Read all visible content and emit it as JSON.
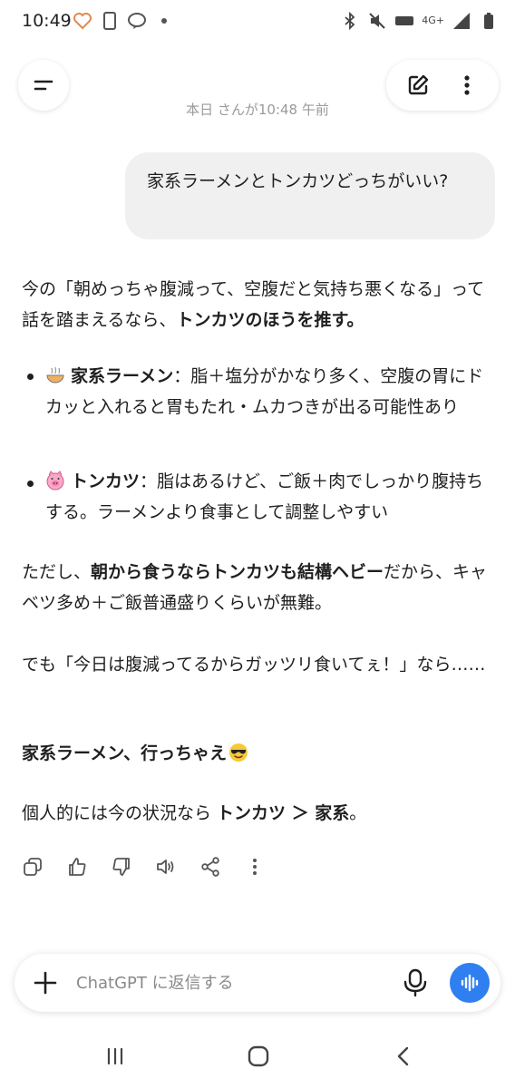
{
  "status": {
    "time": "10:49",
    "signal_label": "4G+"
  },
  "header": {
    "timestamp": "本日 さんが10:48 午前"
  },
  "user_message": "家系ラーメンとトンカツどっちがいい?",
  "response": {
    "intro_pre": "今の「朝めっちゃ腹減って、空腹だと気持ち悪くなる」って話を踏まえるなら、",
    "intro_bold": "トンカツのほうを推す。",
    "bullets": [
      {
        "icon": "ramen-bowl-icon",
        "title": "家系ラーメン",
        "text": "：脂＋塩分がかなり多く、空腹の胃にドカッと入れると胃もたれ・ムカつきが出る可能性あり"
      },
      {
        "icon": "pig-face-icon",
        "title": "トンカツ",
        "text": "：脂はあるけど、ご飯＋肉でしっかり腹持ちする。ラーメンより食事として調整しやすい"
      }
    ],
    "caution_pre": "ただし、",
    "caution_bold": "朝から食うならトンカツも結構ヘビー",
    "caution_post": "だから、キャベツ多め＋ご飯普通盛りくらいが無難。",
    "alt_text": "でも「今日は腹減ってるからガッツリ食いてぇ！」なら……",
    "alt_bold": "家系ラーメン、行っちゃえ",
    "conclusion_pre": "個人的には今の状況なら ",
    "conclusion_bold": "トンカツ ＞ 家系",
    "conclusion_post": "。"
  },
  "input": {
    "placeholder": "ChatGPT に返信する"
  },
  "colors": {
    "voice_button": "#2f7ff0",
    "text": "#1f1f1f",
    "bubble": "#f0f0f0"
  }
}
